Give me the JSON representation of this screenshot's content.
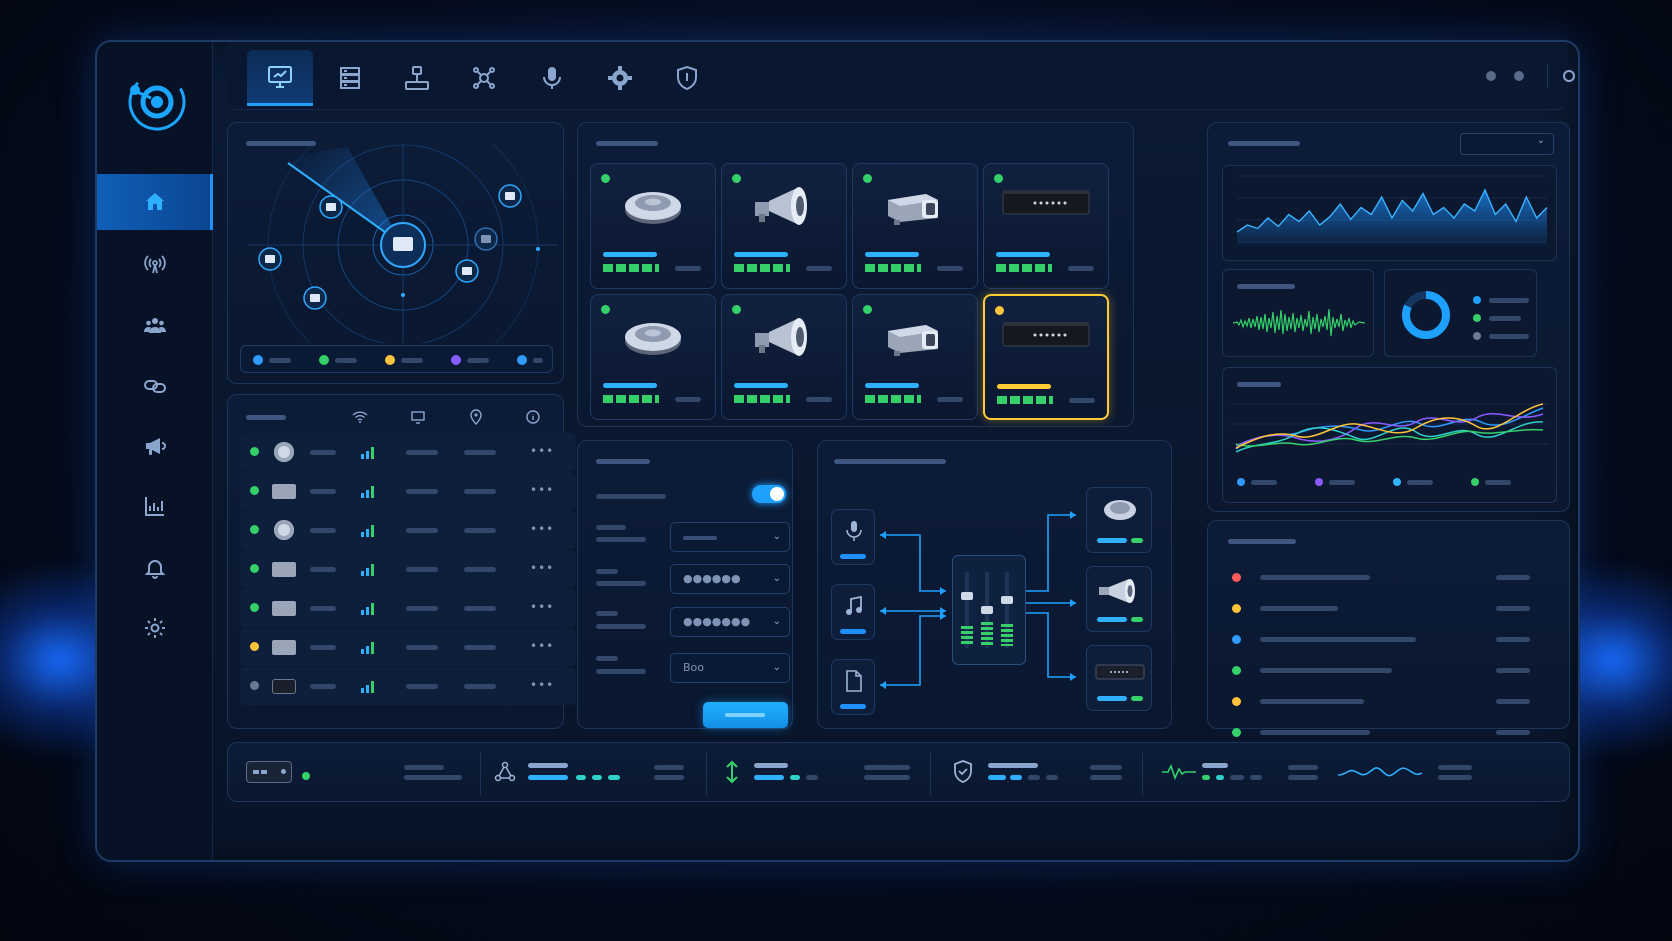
{
  "app": {
    "accent": "#1ea0ff",
    "status_colors": {
      "ok": "#35d06a",
      "warn": "#ffc43a",
      "error": "#ff5a5a",
      "info": "#2f9bff",
      "offline": "#6c7a93",
      "purple": "#8a5cff"
    }
  },
  "sidebar": {
    "items": [
      {
        "name": "home",
        "icon": "home-icon",
        "active": true
      },
      {
        "name": "broadcast",
        "icon": "broadcast-icon",
        "active": false
      },
      {
        "name": "users",
        "icon": "users-icon",
        "active": false
      },
      {
        "name": "links",
        "icon": "link-icon",
        "active": false
      },
      {
        "name": "announcements",
        "icon": "megaphone-icon",
        "active": false
      },
      {
        "name": "reports",
        "icon": "chart-icon",
        "active": false
      },
      {
        "name": "alerts",
        "icon": "bell-icon",
        "active": false
      },
      {
        "name": "settings",
        "icon": "gear-icon",
        "active": false
      }
    ]
  },
  "topbar": {
    "tabs": [
      {
        "icon": "monitor-icon",
        "active": true
      },
      {
        "icon": "server-icon",
        "active": false
      },
      {
        "icon": "network-icon",
        "active": false
      },
      {
        "icon": "nodes-icon",
        "active": false
      },
      {
        "icon": "microphone-icon",
        "active": false
      },
      {
        "icon": "gear-icon",
        "active": false
      },
      {
        "icon": "shield-icon",
        "active": false
      }
    ]
  },
  "map": {
    "legend_colors": [
      "#2f9bff",
      "#35d06a",
      "#ffc43a",
      "#8a5cff",
      "#2f9bff"
    ]
  },
  "devices": {
    "cards": [
      {
        "type": "ceiling-speaker",
        "status": "ok",
        "selected": false
      },
      {
        "type": "horn-speaker",
        "status": "ok",
        "selected": false
      },
      {
        "type": "projector-speaker",
        "status": "ok",
        "selected": false
      },
      {
        "type": "amplifier",
        "status": "ok",
        "selected": false
      },
      {
        "type": "ceiling-speaker",
        "status": "ok",
        "selected": false
      },
      {
        "type": "horn-speaker",
        "status": "ok",
        "selected": false
      },
      {
        "type": "projector-speaker",
        "status": "ok",
        "selected": false
      },
      {
        "type": "amplifier",
        "status": "warn",
        "selected": true
      }
    ]
  },
  "device_list": {
    "header_icons": [
      "wifi-icon",
      "monitor-icon",
      "location-icon",
      "info-icon"
    ],
    "rows": [
      {
        "status": "ok",
        "type": "round"
      },
      {
        "status": "ok",
        "type": "box"
      },
      {
        "status": "ok",
        "type": "round"
      },
      {
        "status": "ok",
        "type": "box"
      },
      {
        "status": "ok",
        "type": "box"
      },
      {
        "status": "warn",
        "type": "box"
      },
      {
        "status": "offline",
        "type": "dark"
      }
    ]
  },
  "config": {
    "toggle_on": true,
    "select_values": [
      "",
      "●●●●●●",
      "●●●●●●●",
      "Boo"
    ]
  },
  "routing": {
    "sources": [
      "microphone-icon",
      "music-icon",
      "file-icon"
    ],
    "outputs": [
      "ceiling-speaker",
      "horn-speaker",
      "amplifier"
    ]
  },
  "charts": {
    "spike": {
      "values": [
        20,
        30,
        25,
        40,
        28,
        45,
        35,
        50,
        30,
        42,
        60,
        38,
        55,
        45,
        70,
        40,
        65,
        50,
        75,
        45,
        55,
        40,
        60,
        50,
        80,
        45,
        60,
        35,
        70,
        40,
        55
      ]
    },
    "multi": {
      "series_colors": [
        "#2f9bff",
        "#8a5cff",
        "#2fb5ff",
        "#35d06a",
        "#ffc43a"
      ]
    },
    "donut": {
      "value": 0.82
    }
  },
  "events": {
    "colors": [
      "#ff5a5a",
      "#ffc43a",
      "#2f9bff",
      "#35d06a",
      "#ffc43a",
      "#35d06a"
    ]
  }
}
